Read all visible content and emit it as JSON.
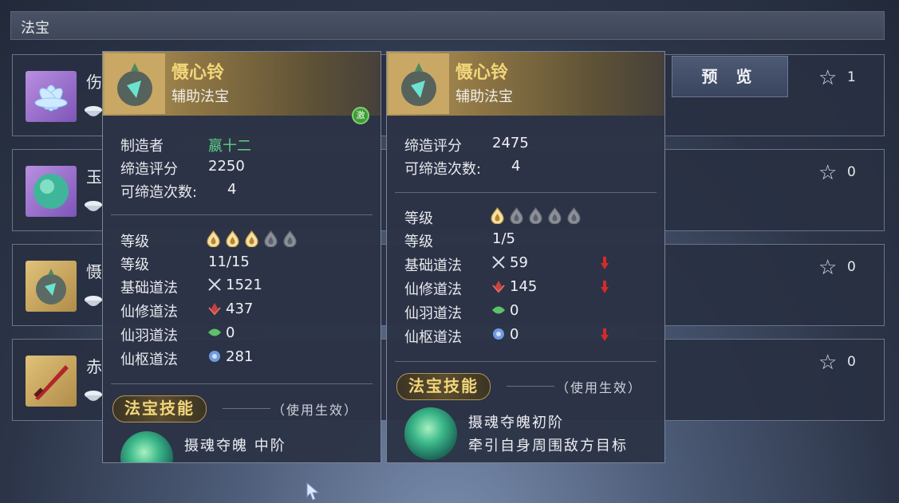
{
  "panel_title": "法宝",
  "preview_button": "预 览",
  "rows": [
    {
      "name": "伤",
      "count": "1"
    },
    {
      "name": "玉",
      "count": "0"
    },
    {
      "name": "慑",
      "count": "0"
    },
    {
      "name": "赤",
      "count": "0"
    }
  ],
  "left_card": {
    "title": "慑心铃",
    "subtitle": "辅助法宝",
    "badge": "激",
    "maker_label": "制造者",
    "maker_value": "嬴十二",
    "score_label": "缔造评分",
    "score_value": "2250",
    "times_label": "可缔造次数:",
    "times_value": "4",
    "level_label": "等级",
    "flames_lit": 3,
    "flames_total": 5,
    "level_label2": "等级",
    "level_value": "11/15",
    "stats": [
      {
        "label": "基础道法",
        "icon": "crossed-swords-icon",
        "value": "1521"
      },
      {
        "label": "仙修道法",
        "icon": "red-lotus-icon",
        "value": "437"
      },
      {
        "label": "仙羽道法",
        "icon": "green-leaf-icon",
        "value": "0"
      },
      {
        "label": "仙枢道法",
        "icon": "blue-flower-icon",
        "value": "281"
      }
    ],
    "skill_header": "法宝技能",
    "skill_effect": "（使用生效）",
    "skill_name": "摄魂夺魄 中阶"
  },
  "right_card": {
    "title": "慑心铃",
    "subtitle": "辅助法宝",
    "score_label": "缔造评分",
    "score_value": "2475",
    "times_label": "可缔造次数:",
    "times_value": "4",
    "level_label": "等级",
    "flames_lit": 1,
    "flames_total": 5,
    "level_label2": "等级",
    "level_value": "1/5",
    "stats": [
      {
        "label": "基础道法",
        "icon": "crossed-swords-icon",
        "value": "59",
        "down": true
      },
      {
        "label": "仙修道法",
        "icon": "red-lotus-icon",
        "value": "145",
        "down": true
      },
      {
        "label": "仙羽道法",
        "icon": "green-leaf-icon",
        "value": "0",
        "down": false
      },
      {
        "label": "仙枢道法",
        "icon": "blue-flower-icon",
        "value": "0",
        "down": true
      }
    ],
    "skill_header": "法宝技能",
    "skill_effect": "（使用生效）",
    "skill_name": "摄魂夺魄初阶",
    "skill_desc": "牵引自身周围敌方目标"
  },
  "colors": {
    "gold_title": "#f2d67a",
    "maker_green": "#5fd08a",
    "down_arrow": "#d42a2a"
  }
}
